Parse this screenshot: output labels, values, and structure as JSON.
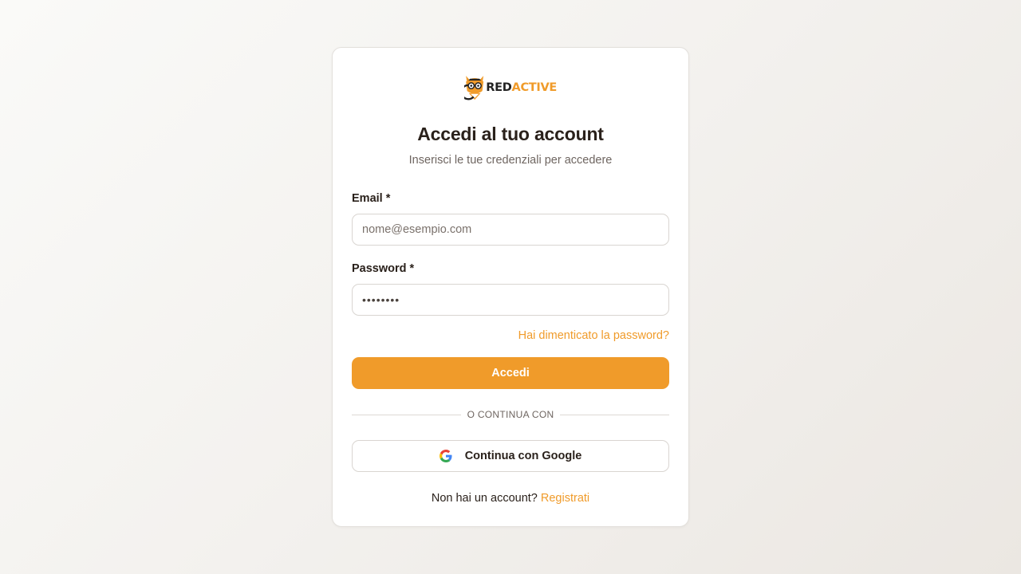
{
  "brand": {
    "name_part1": "RED",
    "name_part2": "ACTIVE",
    "accent_color": "#f09b2a"
  },
  "login": {
    "title": "Accedi al tuo account",
    "subtitle": "Inserisci le tue credenziali per accedere",
    "email_label": "Email *",
    "email_placeholder": "nome@esempio.com",
    "password_label": "Password *",
    "password_value": "••••••••",
    "forgot_link": "Hai dimenticato la password?",
    "submit_label": "Accedi",
    "divider_text": "O CONTINUA CON",
    "google_label": "Continua con Google",
    "signup_prompt": "Non hai un account?",
    "signup_link": "Registrati"
  },
  "icons": {
    "logo": "fox-logo-icon",
    "google": "google-icon"
  }
}
